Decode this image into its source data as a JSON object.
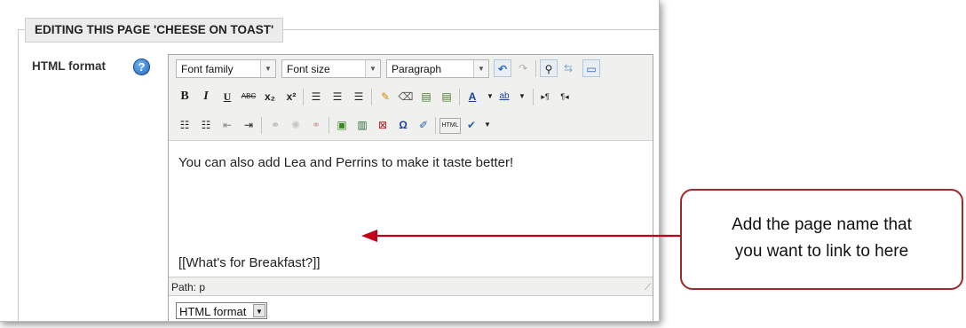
{
  "legend": "EDITING THIS PAGE 'CHEESE ON TOAST'",
  "format_label": "HTML format",
  "toolbar": {
    "font_family": "Font family",
    "font_size": "Font size",
    "paragraph": "Paragraph",
    "arrow_glyph": "▼"
  },
  "content": {
    "line1": "You can also add Lea and Perrins to make it taste better!",
    "line2": "[[What's for Breakfast?]]"
  },
  "statusbar": "Path: p",
  "format_select": "HTML format",
  "callout": {
    "line1": "Add the page name that",
    "line2": "you want to link to here"
  },
  "colors": {
    "callout_border": "#9e2a2a",
    "arrow": "#c0001a",
    "help_icon": "#1f63b6"
  }
}
